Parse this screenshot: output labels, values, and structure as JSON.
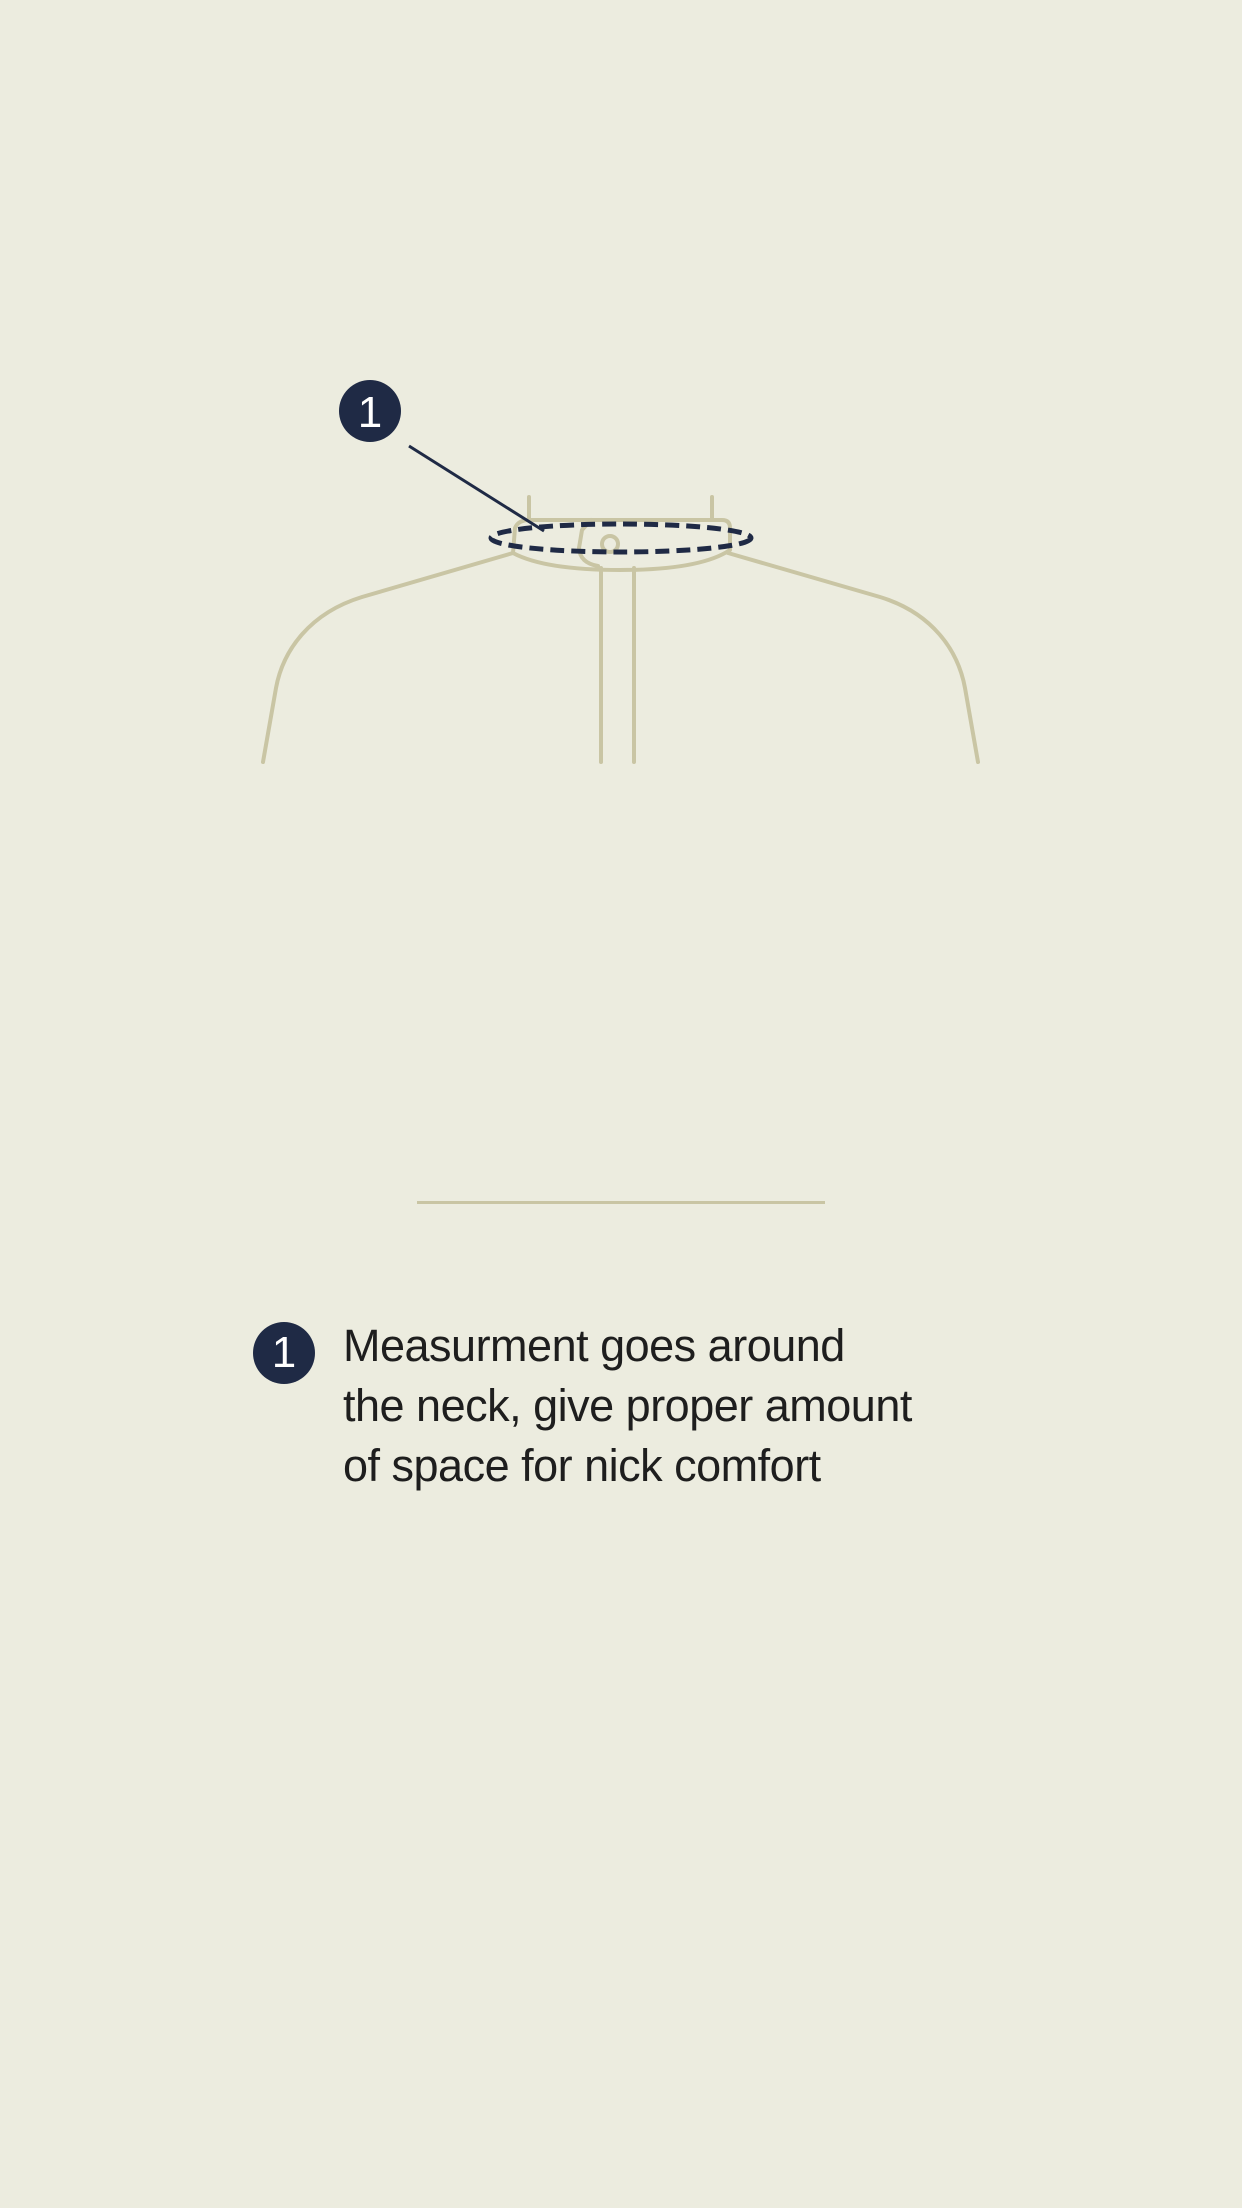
{
  "callouts": [
    {
      "number": "1"
    }
  ],
  "legend": [
    {
      "number": "1",
      "lines": [
        "Measurment goes around",
        "the neck, give proper amount",
        "of space for nick comfort"
      ]
    }
  ],
  "colors": {
    "background": "#ECECDF",
    "garment_outline": "#C9C5A4",
    "accent": "#1F2A45",
    "text": "#1E1E1E"
  }
}
